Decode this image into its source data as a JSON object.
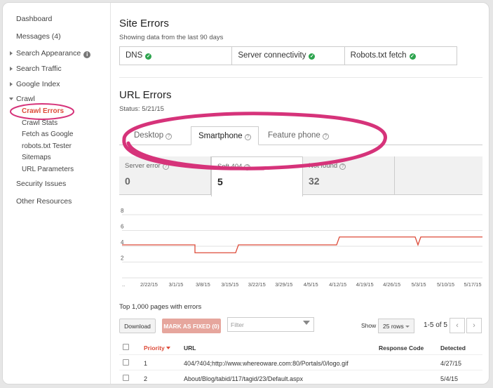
{
  "sidebar": {
    "items": [
      {
        "label": "Dashboard"
      },
      {
        "label": "Messages (4)"
      },
      {
        "label": "Search Appearance"
      },
      {
        "label": "Search Traffic"
      },
      {
        "label": "Google Index"
      },
      {
        "label": "Crawl"
      },
      {
        "label": "Security Issues"
      },
      {
        "label": "Other Resources"
      }
    ],
    "crawl_children": [
      {
        "label": "Crawl Errors"
      },
      {
        "label": "Crawl Stats"
      },
      {
        "label": "Fetch as Google"
      },
      {
        "label": "robots.txt Tester"
      },
      {
        "label": "Sitemaps"
      },
      {
        "label": "URL Parameters"
      }
    ]
  },
  "site_errors": {
    "title": "Site Errors",
    "subtitle": "Showing data from the last 90 days",
    "cells": [
      {
        "label": "DNS"
      },
      {
        "label": "Server connectivity"
      },
      {
        "label": "Robots.txt fetch"
      }
    ]
  },
  "url_errors": {
    "title": "URL Errors",
    "status": "Status: 5/21/15",
    "tabs": [
      {
        "label": "Desktop"
      },
      {
        "label": "Smartphone"
      },
      {
        "label": "Feature phone"
      }
    ],
    "metrics": [
      {
        "label": "Server error",
        "value": "0"
      },
      {
        "label": "Soft 404",
        "value": "5"
      },
      {
        "label": "Not found",
        "value": "32"
      }
    ]
  },
  "chart_data": {
    "type": "line",
    "yticks": [
      "8",
      "6",
      "4",
      "2"
    ],
    "ylim": [
      0,
      8
    ],
    "x_labels": [
      "..",
      "2/22/15",
      "3/1/15",
      "3/8/15",
      "3/15/15",
      "3/22/15",
      "3/29/15",
      "4/5/15",
      "4/12/15",
      "4/19/15",
      "4/26/15",
      "5/3/15",
      "5/10/15",
      "5/17/15"
    ],
    "series": [
      {
        "values": [
          4,
          4,
          4,
          4,
          3,
          3,
          4,
          4,
          4,
          4,
          5,
          5,
          5,
          5,
          4,
          5,
          5,
          5
        ],
        "color": "#dd4b39"
      }
    ],
    "grid": true
  },
  "table_section": {
    "title": "Top 1,000 pages with errors",
    "download": "Download",
    "mark_fixed": "MARK AS FIXED (0)",
    "filter_placeholder": "Filter",
    "show_label": "Show",
    "rows_option": "25 rows",
    "pager": "1-5 of 5",
    "prev": "‹",
    "next": "›",
    "headers": {
      "priority": "Priority",
      "url": "URL",
      "response": "Response Code",
      "detected": "Detected"
    },
    "rows": [
      {
        "priority": "1",
        "url": "404/?404;http://www.whereoware.com:80/Portals/0/logo.gif",
        "response": "",
        "detected": "4/27/15"
      },
      {
        "priority": "2",
        "url": "About/Blog/tabid/117/tagid/23/Default.aspx",
        "response": "",
        "detected": "5/4/15"
      }
    ]
  },
  "colors": {
    "accent": "#dd4b39",
    "annotation": "#d6337a",
    "check": "#2da44e"
  }
}
